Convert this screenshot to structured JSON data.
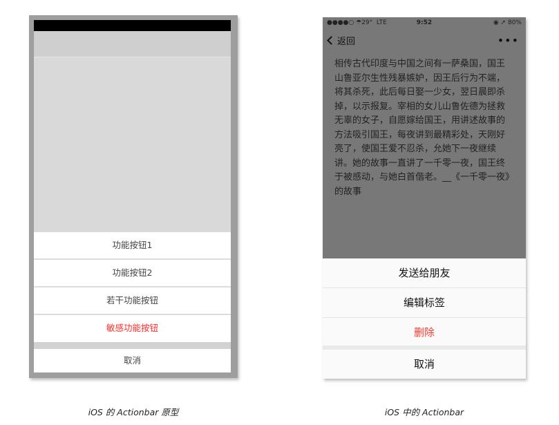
{
  "prototype": {
    "buttons": [
      "功能按钮1",
      "功能按钮2",
      "若干功能按钮",
      "敏感功能按钮"
    ],
    "cancel": "取消",
    "caption": "iOS 的 Actionbar 原型"
  },
  "ios": {
    "status": {
      "signal": "●●●●○",
      "weather": "☂29°",
      "carrier": "LTE",
      "time": "9:52",
      "indicators": "◉ ➚",
      "battery": "80%"
    },
    "nav": {
      "back": "返回",
      "more": "•••"
    },
    "article": "相传古代印度与中国之间有一萨桑国，国王山鲁亚尔生性残暴嫉妒，因王后行为不端，将其杀死，此后每日娶一少女，翌日晨即杀掉，以示报复。宰相的女儿山鲁佐德为拯救无辜的女子，自愿嫁给国王，用讲述故事的方法吸引国王，每夜讲到最精彩处，天刚好亮了，使国王爱不忍杀，允她下一夜继续讲。她的故事一直讲了一千零一夜，国王终于被感动，与她白首偕老。__《一千零一夜》的故事",
    "actions": [
      "发送给朋友",
      "编辑标签",
      "删除"
    ],
    "cancel": "取消",
    "caption": "iOS 中的 Actionbar"
  },
  "colors": {
    "danger": "#ff3b30",
    "overlay": "#787878"
  }
}
